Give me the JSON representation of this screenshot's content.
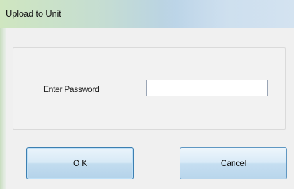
{
  "window": {
    "title": "Upload to Unit"
  },
  "form": {
    "password_label": "Enter Password",
    "password_value": "",
    "password_placeholder": ""
  },
  "buttons": {
    "ok_label": "O K",
    "cancel_label": "Cancel"
  },
  "colors": {
    "titlebar_start": "#cfe6c0",
    "titlebar_end": "#c9dced",
    "dialog_background": "#f0f0f0",
    "button_border": "#3c7fb1"
  }
}
